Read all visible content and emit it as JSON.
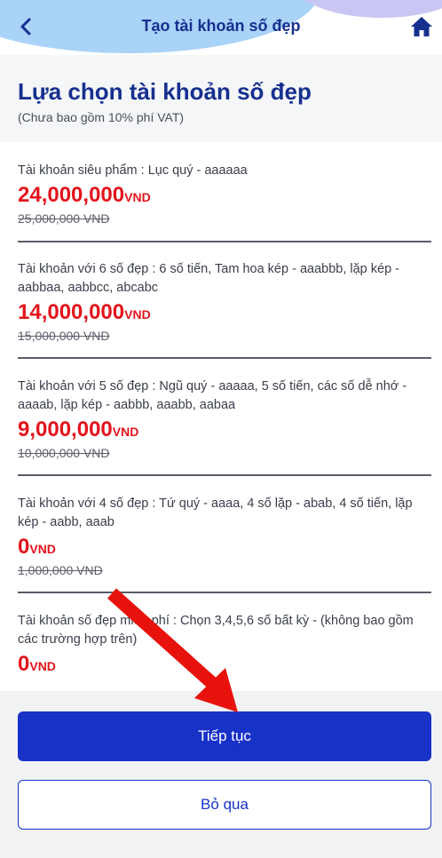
{
  "header": {
    "title": "Tạo tài khoản số đẹp"
  },
  "heading": {
    "title": "Lựa chọn tài khoản số đẹp",
    "subtitle": "(Chưa bao gồm 10% phí VAT)"
  },
  "items": [
    {
      "desc": "Tài khoản siêu phẩm : Lục quý - aaaaaa",
      "price": "24,000,000",
      "unit": "VND",
      "old_price": "25,000,000 VND"
    },
    {
      "desc": "Tài khoản với 6 số đẹp : 6 số tiến, Tam hoa kép - aaabbb, lặp kép - aabbaa, aabbcc, abcabc",
      "price": "14,000,000",
      "unit": "VND",
      "old_price": "15,000,000 VND"
    },
    {
      "desc": "Tài khoản với 5 số đẹp : Ngũ quý - aaaaa, 5 số tiến, các số dễ nhớ - aaaab, lặp kép - aabbb, aaabb, aabaa",
      "price": "9,000,000",
      "unit": "VND",
      "old_price": "10,000,000 VND"
    },
    {
      "desc": "Tài khoản với 4 số đẹp : Tứ quý - aaaa, 4 số lặp - abab, 4 số tiến,  lặp kép - aabb, aaab",
      "price": "0",
      "unit": "VND",
      "old_price": "1,000,000 VND"
    },
    {
      "desc": "Tài khoản số đẹp miễn phí : Chọn 3,4,5,6 số bất kỳ - (không bao gồm các trường hợp trên)",
      "price": "0",
      "unit": "VND",
      "old_price": ""
    }
  ],
  "buttons": {
    "continue": "Tiếp tục",
    "skip": "Bỏ qua"
  },
  "colors": {
    "brand": "#1832c8",
    "price": "#e3141c",
    "arrow": "#e8120c"
  }
}
